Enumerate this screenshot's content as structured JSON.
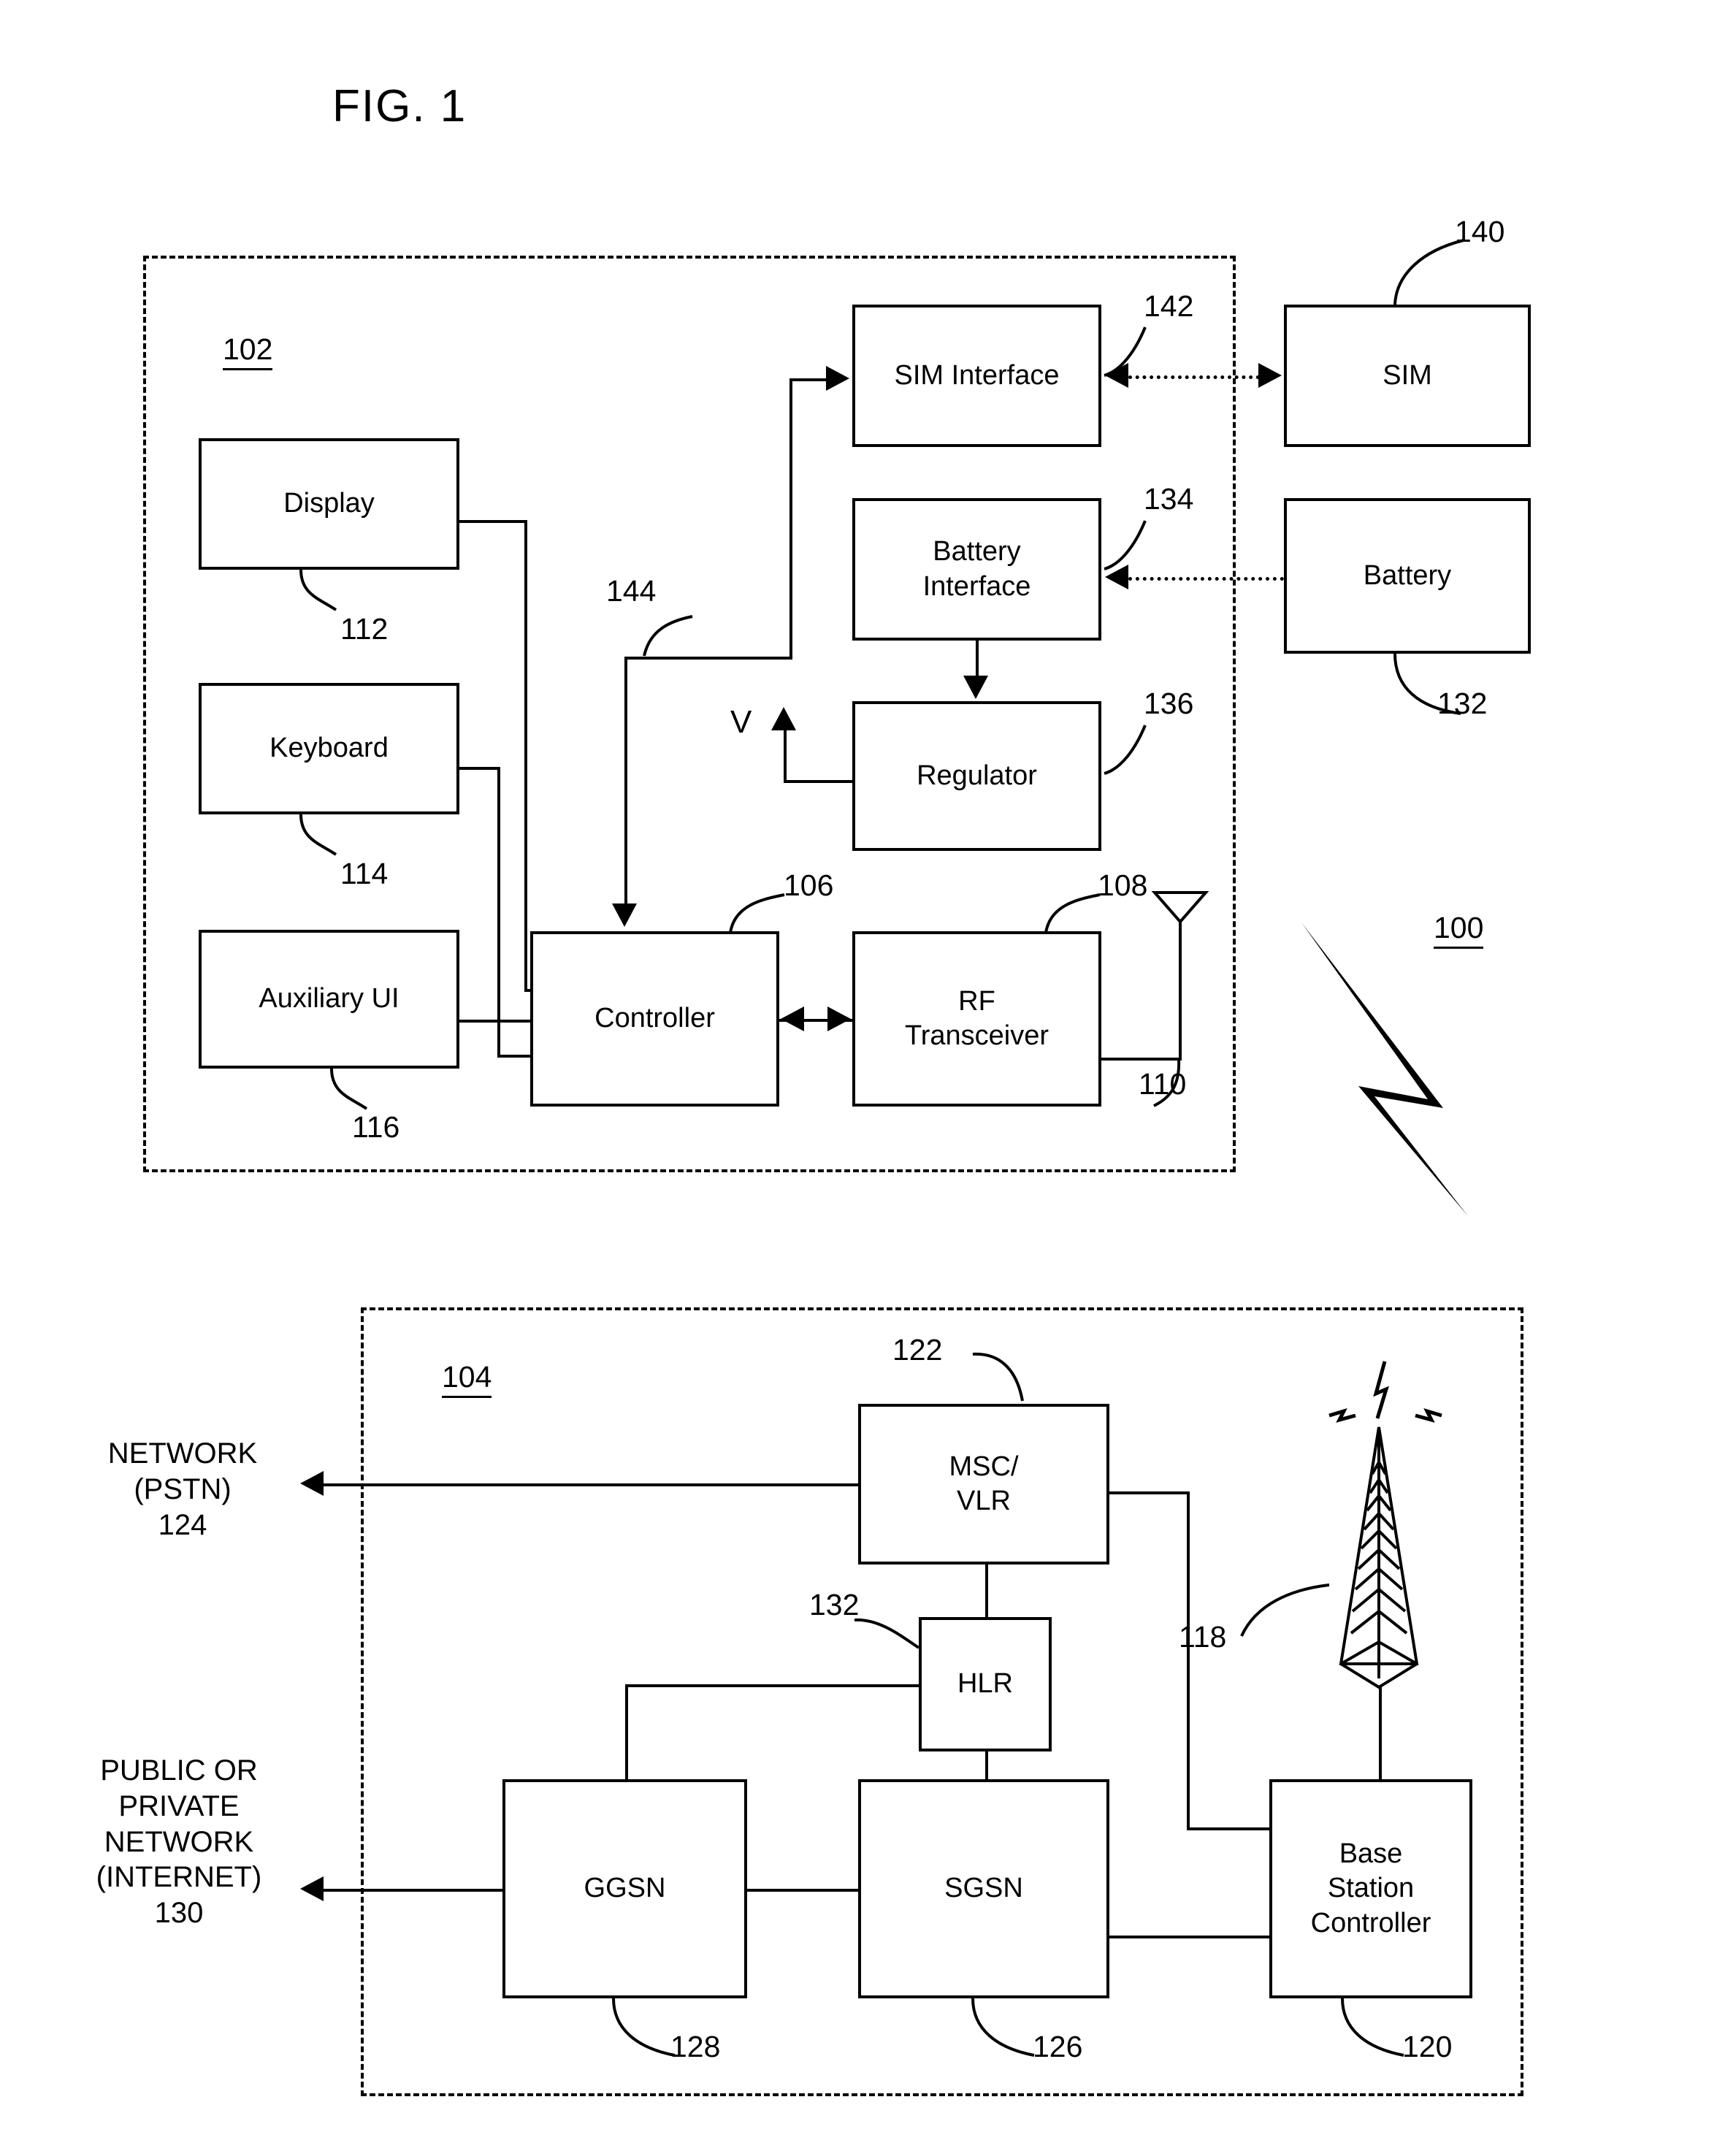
{
  "figure": {
    "title": "FIG. 1",
    "overall_ref": "100"
  },
  "mobile_device": {
    "enclosure_ref": "102",
    "blocks": [
      {
        "id": "display",
        "label": "Display",
        "ref": "112"
      },
      {
        "id": "keyboard",
        "label": "Keyboard",
        "ref": "114"
      },
      {
        "id": "auxiliary-ui",
        "label": "Auxiliary UI",
        "ref": "116"
      },
      {
        "id": "controller",
        "label": "Controller",
        "ref": "106"
      },
      {
        "id": "rf-transceiver",
        "label": "RF\nTransceiver",
        "ref": "108"
      },
      {
        "id": "sim-interface",
        "label": "SIM Interface",
        "ref": "142"
      },
      {
        "id": "battery-interface",
        "label": "Battery\nInterface",
        "ref": "134"
      },
      {
        "id": "regulator",
        "label": "Regulator",
        "ref": "136"
      }
    ],
    "rf_line1": "RF",
    "rf_line2": "Transceiver",
    "battery_if_line1": "Battery",
    "battery_if_line2": "Interface",
    "antenna_ref": "110",
    "bus_ref": "144",
    "voltage_label": "V"
  },
  "external_components": [
    {
      "id": "sim",
      "label": "SIM",
      "ref": "140"
    },
    {
      "id": "battery",
      "label": "Battery",
      "ref": "132"
    }
  ],
  "network": {
    "enclosure_ref": "104",
    "blocks": [
      {
        "id": "msc-vlr",
        "label": "MSC/\nVLR",
        "ref": "122"
      },
      {
        "id": "hlr",
        "label": "HLR",
        "ref": "132"
      },
      {
        "id": "ggsn",
        "label": "GGSN",
        "ref": "128"
      },
      {
        "id": "sgsn",
        "label": "SGSN",
        "ref": "126"
      },
      {
        "id": "bsc",
        "label": "Base\nStation\nController",
        "ref": "120"
      }
    ],
    "msc_line1": "MSC/",
    "msc_line2": "VLR",
    "bsc_line1": "Base",
    "bsc_line2": "Station",
    "bsc_line3": "Controller",
    "tower_ref": "118",
    "pstn_text": "NETWORK\n(PSTN)\n124",
    "internet_text": "PUBLIC OR\nPRIVATE\nNETWORK\n(INTERNET)\n130"
  },
  "colors": {
    "ink": "#000000",
    "paper": "#ffffff"
  }
}
